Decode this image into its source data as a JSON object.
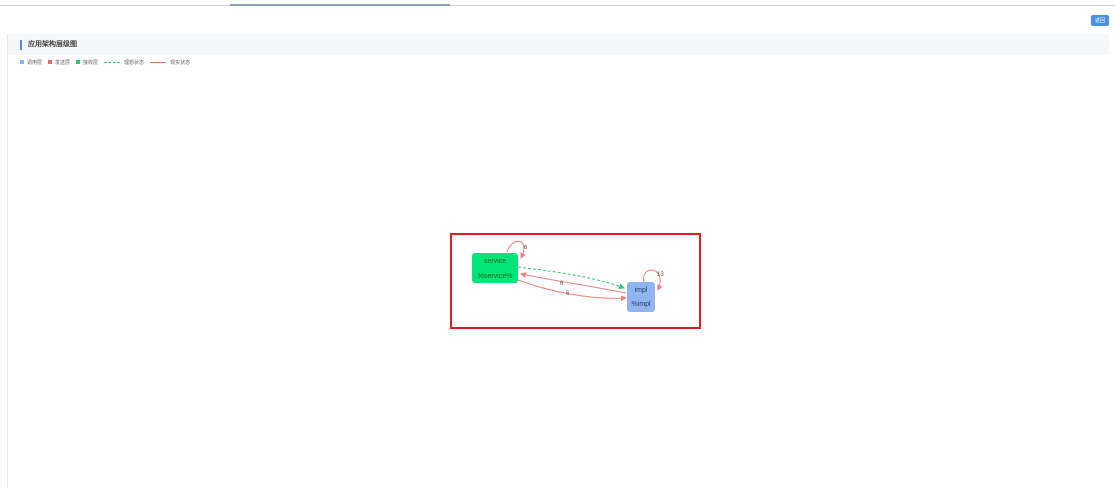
{
  "toolbar": {
    "action_label": "返回"
  },
  "panel": {
    "title": "应用架构层级图"
  },
  "legend": [
    {
      "kind": "square",
      "label": "调用层",
      "color": "#8fb4f0"
    },
    {
      "kind": "square",
      "label": "发送层",
      "color": "#e86a6a"
    },
    {
      "kind": "square",
      "label": "接收层",
      "color": "#2ecc71"
    },
    {
      "kind": "dashed-line",
      "label": "理想状态",
      "color": "#2ecc71"
    },
    {
      "kind": "solid-line",
      "label": "现实状态",
      "color": "#e86a6a"
    }
  ],
  "graph": {
    "nodes": [
      {
        "id": "service",
        "name": "service",
        "sublabel": "%service%",
        "color": "#00e676"
      },
      {
        "id": "impl",
        "name": "impl",
        "sublabel": "%impl",
        "color": "#8fb4f0"
      }
    ],
    "edges": [
      {
        "from": "service",
        "to": "service",
        "label": "6",
        "state": "现实状态"
      },
      {
        "from": "impl",
        "to": "impl",
        "label": "13",
        "state": "现实状态"
      },
      {
        "from": "service",
        "to": "impl",
        "label": "",
        "state": "理想状态"
      },
      {
        "from": "impl",
        "to": "service",
        "label": "6",
        "state": "现实状态"
      },
      {
        "from": "service",
        "to": "impl",
        "label": "6",
        "state": "现实状态"
      }
    ]
  }
}
